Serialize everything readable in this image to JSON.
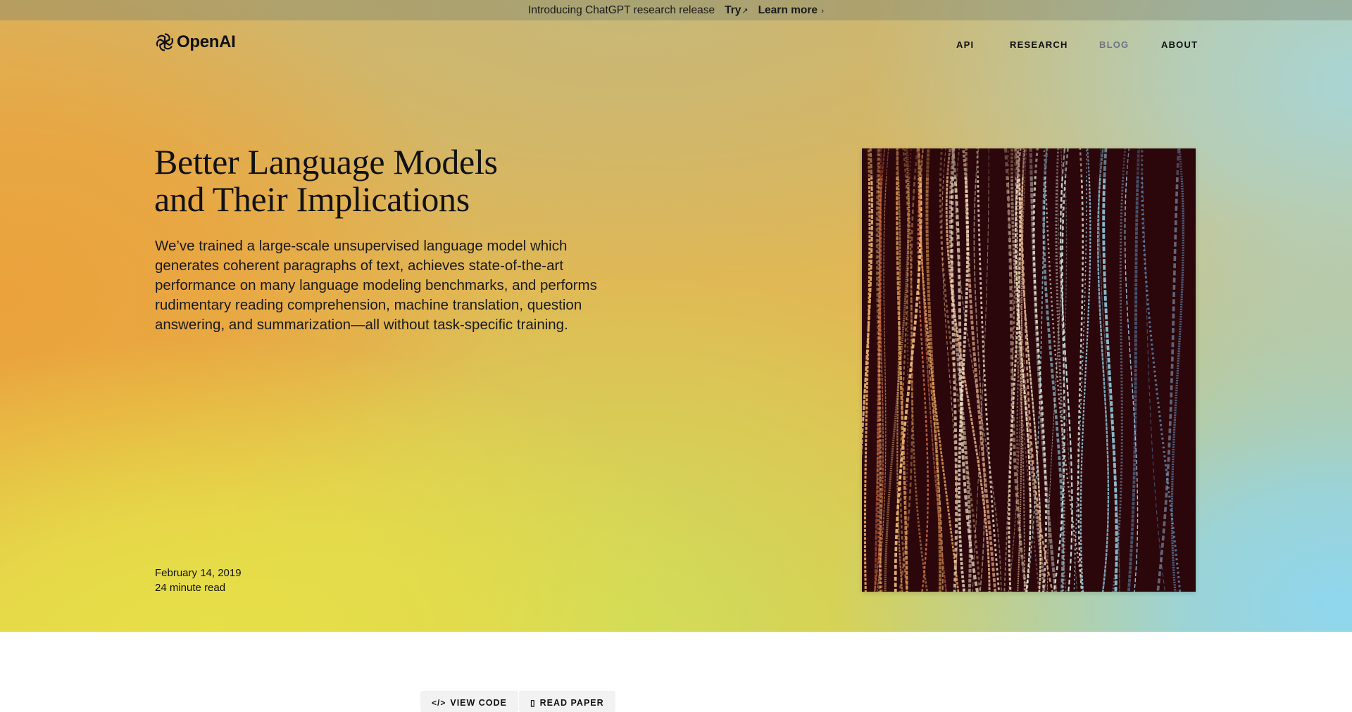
{
  "banner": {
    "intro": "Introducing ChatGPT research release",
    "try_label": "Try",
    "try_arrow": "↗",
    "learn_label": "Learn more",
    "learn_arrow": "›"
  },
  "brand": {
    "name": "OpenAI",
    "logo_icon": "openai-logo-icon"
  },
  "nav": [
    {
      "label": "API",
      "active": true
    },
    {
      "label": "RESEARCH",
      "active": true
    },
    {
      "label": "BLOG",
      "active": false
    },
    {
      "label": "ABOUT",
      "active": true
    }
  ],
  "article": {
    "title_line1": "Better Language Models",
    "title_line2": "and Their Implications",
    "description": "We’ve trained a large-scale unsupervised language model which generates coherent paragraphs of text, achieves state-of-the-art performance on many language modeling benchmarks, and performs rudimentary reading comprehension, machine translation, question answering, and summarization—all without task-specific training.",
    "date": "February 14, 2019",
    "read_time": "24 minute read",
    "cover_image": "text-streams-artwork"
  },
  "actions": {
    "view_code": {
      "label": "VIEW CODE",
      "icon": "code-icon"
    },
    "read_paper": {
      "label": "READ PAPER",
      "icon": "document-icon"
    }
  },
  "colors": {
    "artwork_background": "#2b070c",
    "muted_nav": "#6f7580"
  }
}
